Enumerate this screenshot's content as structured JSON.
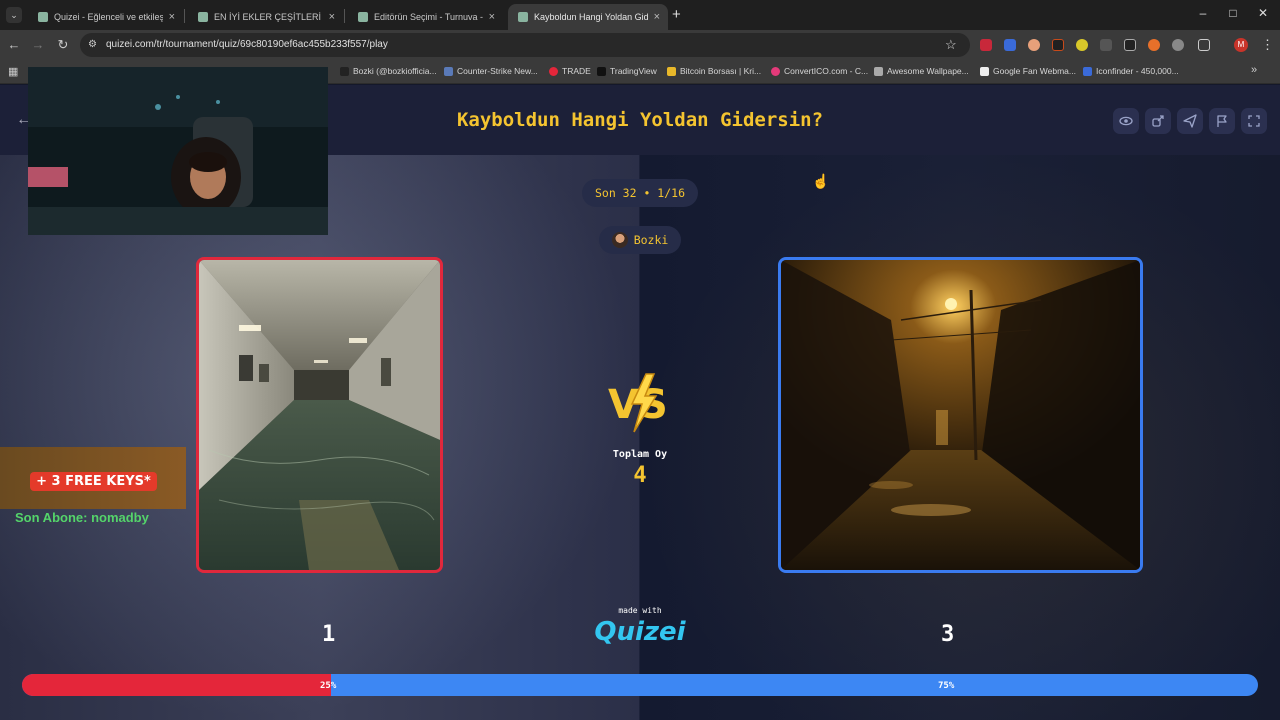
{
  "browser": {
    "tabs": [
      {
        "title": "Quizei - Eğlenceli ve etkileşimli",
        "active": false
      },
      {
        "title": "EN İYİ EKLER ÇEŞİTLERİ - Tier Li",
        "active": false
      },
      {
        "title": "Editörün Seçimi - Turnuva - Qui",
        "active": false
      },
      {
        "title": "Kayboldun Hangi Yoldan Giders",
        "active": true
      }
    ],
    "new_tab": "+",
    "url": "quizei.com/tr/tournament/quiz/69c80190ef6ac455b233f557/play",
    "bookmarks": [
      "Bozki (@bozkiofficia...",
      "Counter-Strike New...",
      "TRADE",
      "TradingView",
      "Bitcoin Borsası | Kri...",
      "ConvertICO.com - C...",
      "Awesome Wallpape...",
      "Google Fan Webma...",
      "Iconfinder - 450,000..."
    ],
    "more_bookmarks": "»"
  },
  "quiz": {
    "title": "Kayboldun Hangi Yoldan Gidersin?",
    "round": "Son 32 • 1/16",
    "creator": "Bozki",
    "votes_label": "Toplam Oy",
    "votes_total": "4",
    "left_count": "1",
    "right_count": "3",
    "left_percent_label": "25%",
    "right_percent_label": "75%",
    "left_fraction": 0.25,
    "made_with": "made with",
    "brand": "Quizei",
    "vs": "VS",
    "left_color": "#e4263a",
    "right_color": "#3d87f3",
    "accent": "#f4c430"
  },
  "overlay": {
    "promo": "+ 3 FREE KEYS*",
    "sub_text": "Son Abone: nomadby"
  }
}
